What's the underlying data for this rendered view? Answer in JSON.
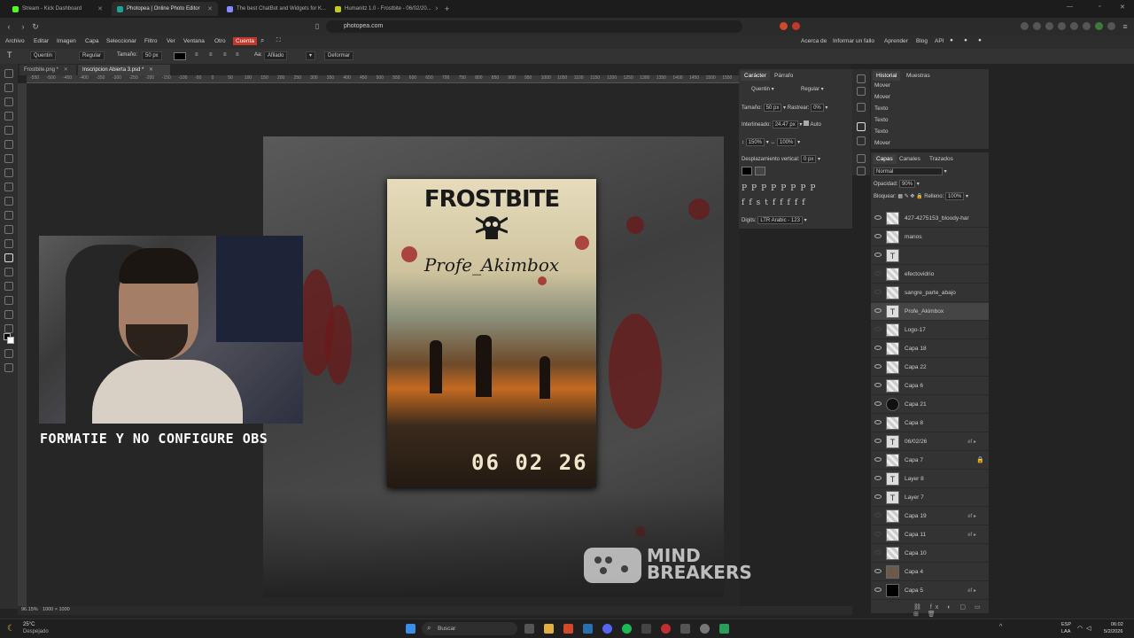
{
  "browser": {
    "tabs": [
      {
        "label": "Stream - Kick Dashboard",
        "color": "#53fc18"
      },
      {
        "label": "Photopea | Online Photo Editor",
        "color": "#18a497",
        "active": true
      },
      {
        "label": "The best ChatBot and Widgets for K...",
        "color": "#8888ff"
      },
      {
        "label": "Humanitz 1.0 - Frostbite - 06/02/20...",
        "color": "#c9c91e"
      }
    ],
    "url": "photopea.com"
  },
  "menu": {
    "items": [
      "Archivo",
      "Editar",
      "Imagen",
      "Capa",
      "Seleccionar",
      "Filtro",
      "Ver",
      "Ventana",
      "Otro"
    ],
    "cuenta": "Cuenta",
    "right": [
      "Acerca de",
      "Informar un fallo",
      "Aprender",
      "Blog",
      "API"
    ]
  },
  "options": {
    "font": "Quentin",
    "style": "Regular",
    "size_label": "Tamaño:",
    "size": "50 px",
    "aa_label": "Aa:",
    "aa": "Afilado",
    "deform": "Deformar"
  },
  "doc_tabs": [
    "Frostbite.png *",
    "Inscripcion Abierta 3.psd *"
  ],
  "ruler": [
    "-550",
    "-500",
    "-450",
    "-400",
    "-350",
    "-300",
    "-250",
    "-200",
    "-150",
    "-100",
    "-50",
    "0",
    "50",
    "100",
    "150",
    "200",
    "250",
    "300",
    "350",
    "400",
    "450",
    "500",
    "550",
    "600",
    "650",
    "700",
    "750",
    "800",
    "850",
    "900",
    "950",
    "1000",
    "1050",
    "1100",
    "1150",
    "1200",
    "1250",
    "1300",
    "1350",
    "1400",
    "1450",
    "1500",
    "1550"
  ],
  "poster": {
    "title": "FROSTBITE",
    "name": "Profe_Akimbox",
    "date": "06 02 26",
    "brand": "MIND BREAKERS"
  },
  "overlay": {
    "caption": "FORMATIE Y NO CONFIGURE OBS"
  },
  "character": {
    "tabs": [
      "Carácter",
      "Párrafo"
    ],
    "font": "Quentin",
    "style": "Regular",
    "size_label": "Tamaño:",
    "size": "50 px",
    "track_label": "Rastrear:",
    "track": "0%",
    "leading_label": "Interlineado:",
    "leading": "24.47 px",
    "auto": "Auto",
    "vscale": "150%",
    "hscale": "100%",
    "vshift_label": "Desplazamiento vertical:",
    "vshift": "0 px",
    "digits_label": "Digits:",
    "digits": "LTR Arabic - 123"
  },
  "history": {
    "tabs": [
      "Historial",
      "Muestras"
    ],
    "items": [
      "Mover",
      "Mover",
      "Texto",
      "Texto",
      "Texto",
      "Mover"
    ]
  },
  "layers": {
    "tabs": [
      "Capas",
      "Canales",
      "Trazados"
    ],
    "blend": "Normal",
    "opacity_label": "Opacidad:",
    "opacity": "90%",
    "lock_label": "Bloquear:",
    "fill_label": "Relleno:",
    "fill": "100%",
    "items": [
      {
        "name": "427-4275153_bloody-har",
        "type": "img",
        "vis": true
      },
      {
        "name": "manos",
        "type": "img",
        "vis": true
      },
      {
        "name": "",
        "type": "text",
        "vis": true
      },
      {
        "name": "efectovidrio",
        "type": "img",
        "vis": false
      },
      {
        "name": "sangre_parte_abajo",
        "type": "img",
        "vis": false
      },
      {
        "name": "Profe_Akimbox",
        "type": "text",
        "vis": true,
        "selected": true
      },
      {
        "name": "Logo-17",
        "type": "img",
        "vis": false
      },
      {
        "name": "Capa 18",
        "type": "img",
        "vis": true
      },
      {
        "name": "Capa 22",
        "type": "img",
        "vis": true
      },
      {
        "name": "Capa 6",
        "type": "img",
        "vis": true
      },
      {
        "name": "Capa 21",
        "type": "dark",
        "vis": true
      },
      {
        "name": "Capa 8",
        "type": "img",
        "vis": true
      },
      {
        "name": "06/02/26",
        "type": "text",
        "vis": true,
        "fx": true
      },
      {
        "name": "Capa 7",
        "type": "img",
        "vis": true,
        "lock": true
      },
      {
        "name": "Layer 8",
        "type": "text",
        "vis": true
      },
      {
        "name": "Layer 7",
        "type": "text",
        "vis": true
      },
      {
        "name": "Capa 19",
        "type": "img",
        "vis": false,
        "fx": true
      },
      {
        "name": "Capa 11",
        "type": "img",
        "vis": false,
        "fx": true
      },
      {
        "name": "Capa 10",
        "type": "img",
        "vis": false
      },
      {
        "name": "Capa 4",
        "type": "photo",
        "vis": true
      },
      {
        "name": "Capa 5",
        "type": "black",
        "vis": true,
        "fx": true
      }
    ]
  },
  "status": {
    "zoom": "96.15%",
    "size": "1000 × 1000"
  },
  "taskbar": {
    "weather_temp": "25°C",
    "weather_desc": "Despejado",
    "search": "Buscar",
    "lang": "ESP",
    "lang2": "LAA",
    "time": "06:02",
    "date": "5/2/2026"
  }
}
